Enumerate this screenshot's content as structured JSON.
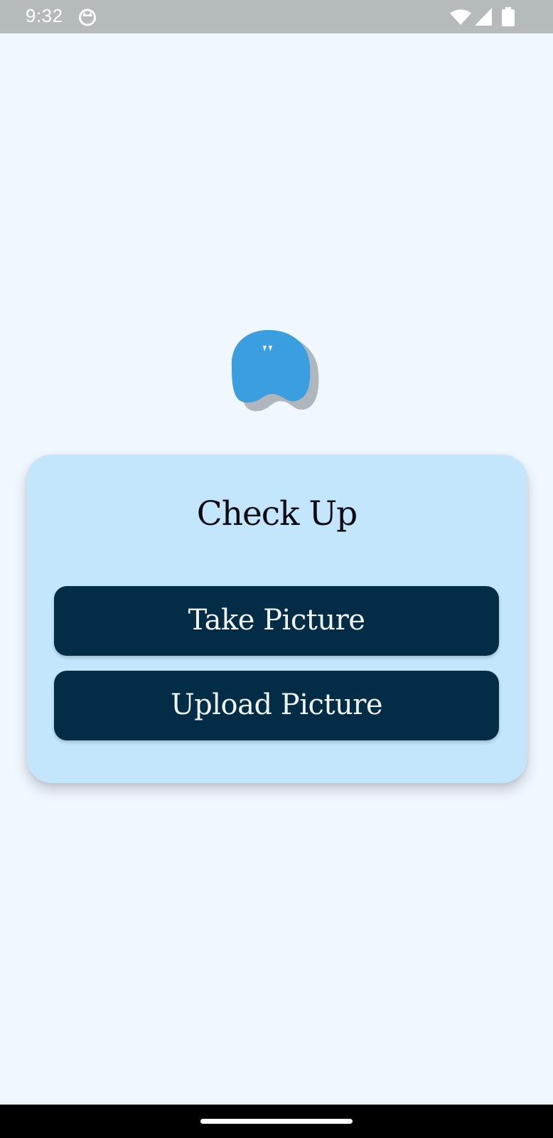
{
  "status_bar": {
    "time": "9:32",
    "icons": [
      "cat-app-icon",
      "wifi-icon",
      "signal-icon",
      "battery-icon"
    ]
  },
  "logo": {
    "icon": "tooth-logo-icon",
    "color": "#3a9ee0"
  },
  "card": {
    "title": "Check Up",
    "background": "#c3e6fc"
  },
  "buttons": {
    "take_picture": "Take Picture",
    "upload_picture": "Upload Picture",
    "color": "#032d46"
  },
  "nav_bar": {
    "handle": "home-gesture-handle"
  }
}
